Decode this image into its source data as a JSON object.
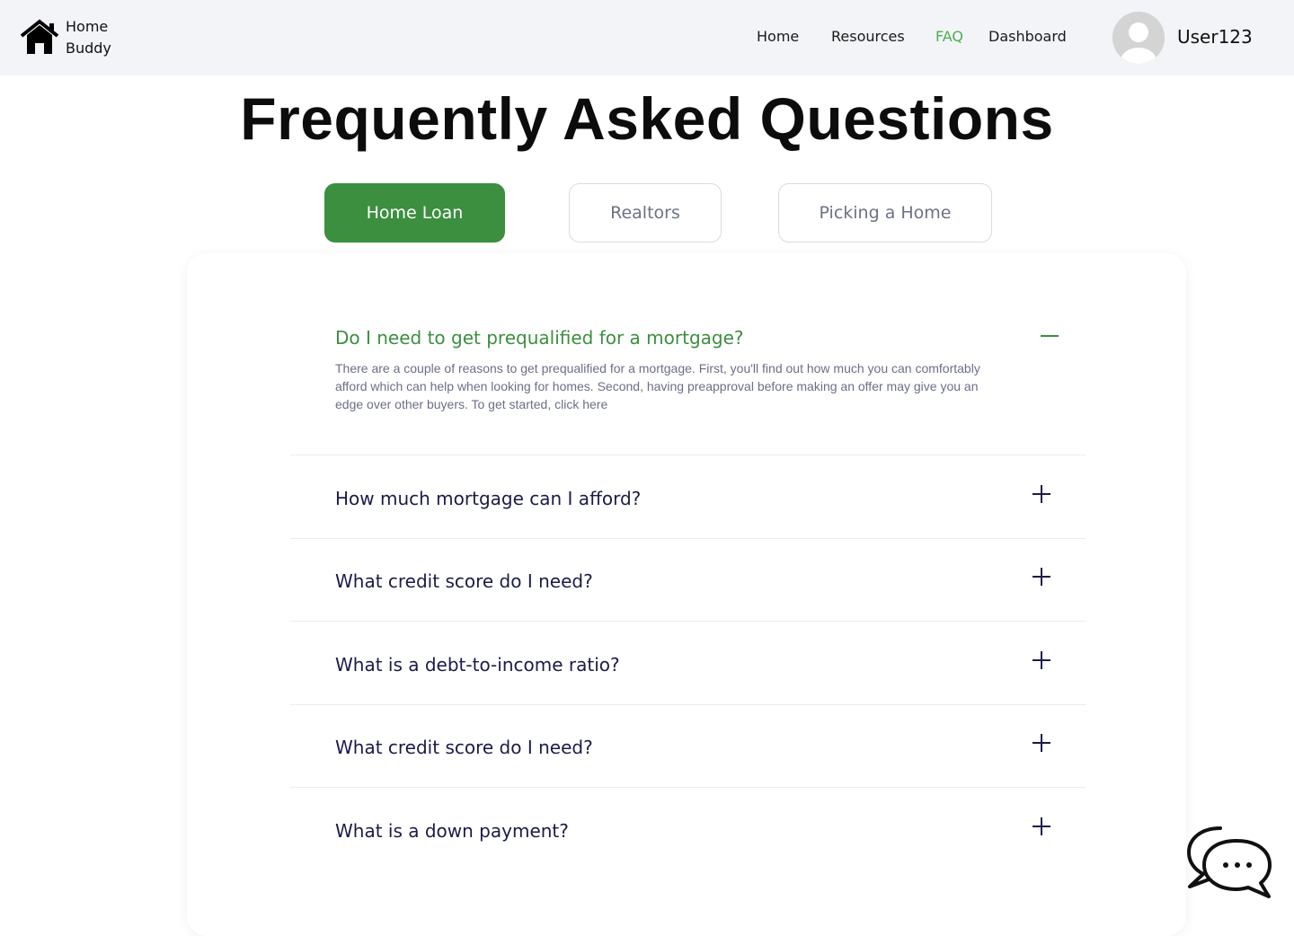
{
  "header": {
    "logo_line1": "Home",
    "logo_line2": "Buddy",
    "nav": [
      {
        "label": "Home",
        "active": false
      },
      {
        "label": "Resources",
        "active": false
      },
      {
        "label": "FAQ",
        "active": true
      },
      {
        "label": "Dashboard",
        "active": false
      }
    ],
    "username": "User123"
  },
  "title": "Frequently Asked Questions",
  "tabs": [
    {
      "label": "Home Loan",
      "active": true
    },
    {
      "label": "Realtors",
      "active": false
    },
    {
      "label": "Picking a Home",
      "active": false
    }
  ],
  "faq": {
    "open": {
      "question": "Do I need to get prequalified for a mortgage?",
      "answer": "There are a couple of reasons to get prequalified for a mortgage. First, you'll find out how much you can comfortably afford which can help when looking for homes. Second, having preapproval before making an offer may give you an edge over other buyers. To get started, click here"
    },
    "items": [
      {
        "question": "How much mortgage can I afford?"
      },
      {
        "question": "What credit score do I need?"
      },
      {
        "question": "What is a debt-to-income ratio?"
      },
      {
        "question": "What credit score do I need?"
      },
      {
        "question": "What is a down payment?"
      }
    ]
  },
  "colors": {
    "accent": "#3b8f3f",
    "nav_active": "#4caf50",
    "question_text": "#1b1b4a",
    "answer_text": "#6b6f87",
    "header_bg": "#f3f4f8"
  },
  "icons": {
    "logo": "house-icon",
    "collapse": "minus-icon",
    "expand": "plus-icon",
    "chat": "chat-bubbles-icon",
    "avatar": "user-avatar-icon"
  }
}
